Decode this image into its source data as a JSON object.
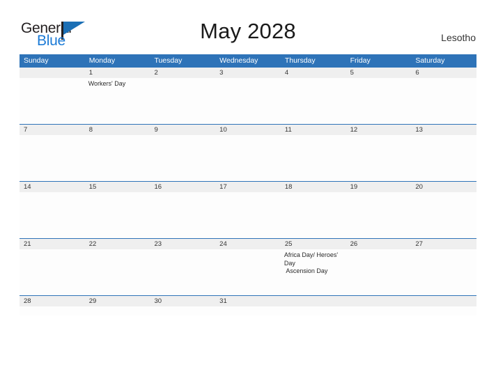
{
  "logo": {
    "word_one": "General",
    "word_two": "Blue",
    "icon": "flag-triangle-icon",
    "color_dark": "#231f20",
    "color_blue": "#1b7ad6"
  },
  "header": {
    "title": "May 2028",
    "country": "Lesotho"
  },
  "theme": {
    "header_blue": "#2e73b8",
    "daynum_band": "#efefef",
    "cell_background": "#fdfdfd",
    "text": "#333333"
  },
  "calendar": {
    "weekdays": [
      "Sunday",
      "Monday",
      "Tuesday",
      "Wednesday",
      "Thursday",
      "Friday",
      "Saturday"
    ],
    "weeks": [
      {
        "days": [
          {
            "num": "",
            "events": []
          },
          {
            "num": "1",
            "events": [
              "Workers' Day"
            ]
          },
          {
            "num": "2",
            "events": []
          },
          {
            "num": "3",
            "events": []
          },
          {
            "num": "4",
            "events": []
          },
          {
            "num": "5",
            "events": []
          },
          {
            "num": "6",
            "events": []
          }
        ]
      },
      {
        "days": [
          {
            "num": "7",
            "events": []
          },
          {
            "num": "8",
            "events": []
          },
          {
            "num": "9",
            "events": []
          },
          {
            "num": "10",
            "events": []
          },
          {
            "num": "11",
            "events": []
          },
          {
            "num": "12",
            "events": []
          },
          {
            "num": "13",
            "events": []
          }
        ]
      },
      {
        "days": [
          {
            "num": "14",
            "events": []
          },
          {
            "num": "15",
            "events": []
          },
          {
            "num": "16",
            "events": []
          },
          {
            "num": "17",
            "events": []
          },
          {
            "num": "18",
            "events": []
          },
          {
            "num": "19",
            "events": []
          },
          {
            "num": "20",
            "events": []
          }
        ]
      },
      {
        "days": [
          {
            "num": "21",
            "events": []
          },
          {
            "num": "22",
            "events": []
          },
          {
            "num": "23",
            "events": []
          },
          {
            "num": "24",
            "events": []
          },
          {
            "num": "25",
            "events": [
              "Africa Day/ Heroes' Day",
              " Ascension Day"
            ]
          },
          {
            "num": "26",
            "events": []
          },
          {
            "num": "27",
            "events": []
          }
        ]
      },
      {
        "short": true,
        "days": [
          {
            "num": "28",
            "events": []
          },
          {
            "num": "29",
            "events": []
          },
          {
            "num": "30",
            "events": []
          },
          {
            "num": "31",
            "events": []
          },
          {
            "num": "",
            "events": []
          },
          {
            "num": "",
            "events": []
          },
          {
            "num": "",
            "events": []
          }
        ]
      }
    ]
  }
}
